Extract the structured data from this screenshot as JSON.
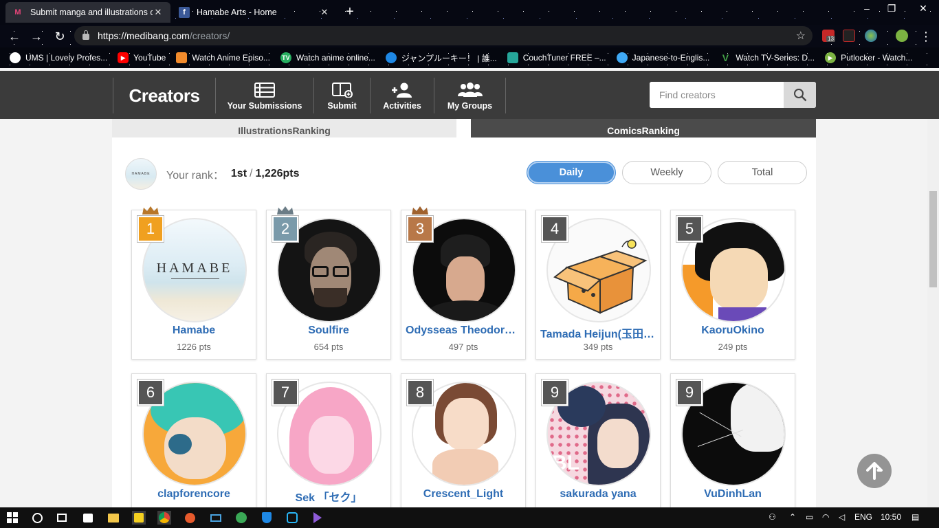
{
  "browser": {
    "tabs": [
      {
        "title": "Submit manga and illustrations o",
        "active": true
      },
      {
        "title": "Hamabe Arts - Home",
        "active": false
      }
    ],
    "url_host": "https://medibang.com",
    "url_path": "/creators/",
    "ext_badge": "13",
    "bookmarks": [
      {
        "label": "UMS | Lovely Profes...",
        "icon": "globe-icon",
        "color": "#ffffff"
      },
      {
        "label": "YouTube",
        "icon": "youtube-icon",
        "color": "#ff0000"
      },
      {
        "label": "Watch Anime Episo...",
        "icon": "watch-anime-icon",
        "color": "#f28b2c"
      },
      {
        "label": "Watch anime online...",
        "icon": "tv-icon",
        "color": "#27ae60"
      },
      {
        "label": "ジャンプルーキー！ | 誰...",
        "icon": "jump-icon",
        "color": "#1e88e5"
      },
      {
        "label": "CouchTuner FREE –...",
        "icon": "couchtuner-icon",
        "color": "#26a69a"
      },
      {
        "label": "Japanese-to-Englis...",
        "icon": "bird-icon",
        "color": "#3fa9f5"
      },
      {
        "label": "Watch TV-Series: D...",
        "icon": "v-icon",
        "color": "#43a047"
      },
      {
        "label": "Putlocker - Watch...",
        "icon": "play-icon",
        "color": "#7cb342"
      }
    ]
  },
  "header": {
    "brand": "Creators",
    "nav": [
      {
        "label": "Your Submissions",
        "icon": "submissions-icon"
      },
      {
        "label": "Submit",
        "icon": "submit-icon"
      },
      {
        "label": "Activities",
        "icon": "activities-icon"
      },
      {
        "label": "My Groups",
        "icon": "groups-icon"
      }
    ],
    "search_placeholder": "Find creators"
  },
  "ranking": {
    "tabs": [
      "IllustrationsRanking",
      "ComicsRanking"
    ],
    "active_tab": "ComicsRanking",
    "your_rank_label": "Your rank：",
    "your_rank": "1st",
    "your_points": "1,226pts",
    "your_avatar_text": "HAMABE",
    "periods": [
      "Daily",
      "Weekly",
      "Total"
    ],
    "active_period": "Daily",
    "creators": [
      {
        "rank": "1",
        "name": "Hamabe",
        "pts": "1226 pts",
        "badge_color": "#f0a020",
        "crown": "#b8772a"
      },
      {
        "rank": "2",
        "name": "Soulfire",
        "pts": "654 pts",
        "badge_color": "#7a9aaa",
        "crown": "#6b7c86"
      },
      {
        "rank": "3",
        "name": "Odysseas Theodoropoulos",
        "pts": "497 pts",
        "badge_color": "#b87848",
        "crown": "#a0622e"
      },
      {
        "rank": "4",
        "name": "Tamada Heijun(玉田平準)",
        "pts": "349 pts",
        "badge_color": "#555555"
      },
      {
        "rank": "5",
        "name": "KaoruOkino",
        "pts": "249 pts",
        "badge_color": "#555555"
      },
      {
        "rank": "6",
        "name": "clapforencore",
        "pts": "",
        "badge_color": "#555555"
      },
      {
        "rank": "7",
        "name": "Sek 「セク」",
        "pts": "",
        "badge_color": "#555555"
      },
      {
        "rank": "8",
        "name": "Crescent_Light",
        "pts": "",
        "badge_color": "#555555"
      },
      {
        "rank": "9",
        "name": "sakurada yana",
        "pts": "",
        "badge_color": "#555555"
      },
      {
        "rank": "9",
        "name": "VuDinhLan",
        "pts": "",
        "badge_color": "#555555"
      }
    ],
    "hamabe_avatar_text": "HAMABE"
  },
  "taskbar": {
    "lang": "ENG",
    "time": "10:50"
  }
}
